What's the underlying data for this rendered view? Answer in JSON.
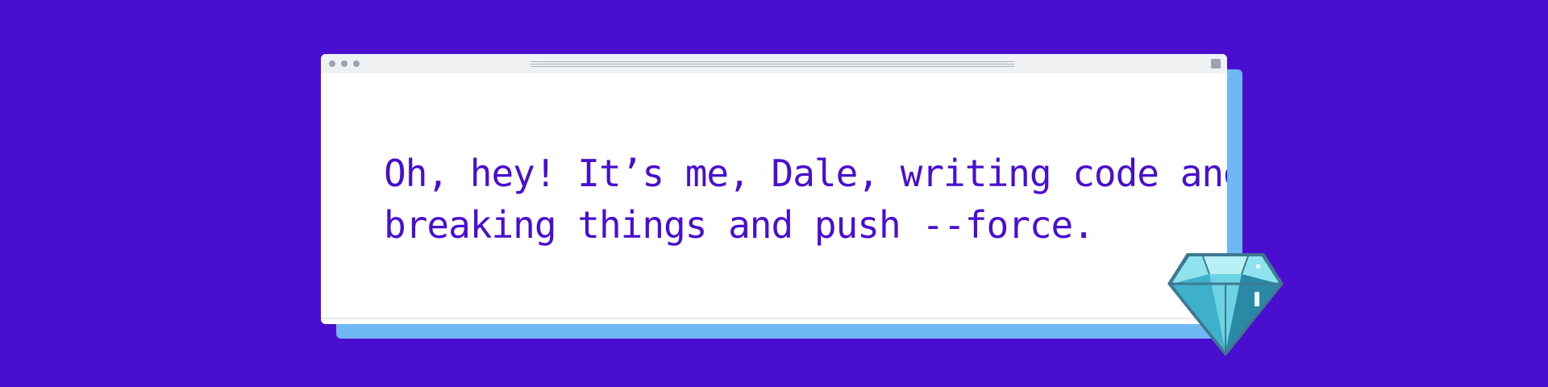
{
  "colors": {
    "background": "#4a0ed1",
    "shadow": "#6fb8f5",
    "text": "#4a0ed1",
    "window": "#ffffff",
    "titlebar": "#eff1f3",
    "gem_light": "#8fe3ee",
    "gem_mid": "#52c4d8",
    "gem_dark": "#2a8aa5",
    "gem_outline": "#3d7a92"
  },
  "window": {
    "titlebar_dots": [
      "dot",
      "dot",
      "dot"
    ]
  },
  "message": {
    "lines": [
      "Oh, hey! It’s me, Dale, writing code and",
      "breaking things and push --force."
    ]
  },
  "decoration": {
    "icon": "diamond-gem-icon"
  }
}
